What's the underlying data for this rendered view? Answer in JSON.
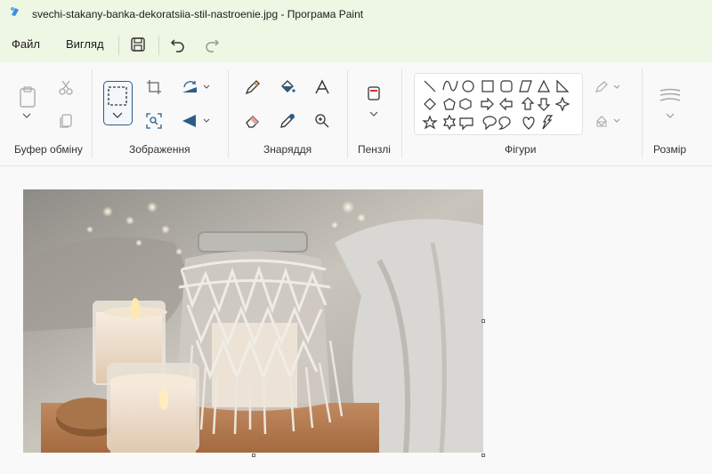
{
  "window": {
    "title": "svechi-stakany-banka-dekoratsiia-stil-nastroenie.jpg - Програма Paint",
    "app_icon": "paint-palette-icon"
  },
  "menubar": {
    "items": [
      "Файл",
      "Вигляд"
    ],
    "icons": [
      "save-icon",
      "undo-icon",
      "redo-icon"
    ]
  },
  "ribbon": {
    "groups": [
      {
        "label": "Буфер обміну",
        "tools": [
          "paste-icon",
          "cut-icon",
          "copy-icon"
        ]
      },
      {
        "label": "Зображення",
        "tools": [
          "select-icon",
          "crop-icon",
          "rotate-icon",
          "image-search-icon",
          "flip-icon"
        ]
      },
      {
        "label": "Знаряддя",
        "tools": [
          "pencil-icon",
          "fill-icon",
          "text-icon",
          "eraser-icon",
          "color-picker-icon",
          "magnifier-icon"
        ]
      },
      {
        "label": "Пензлі",
        "tools": [
          "brush-icon"
        ]
      },
      {
        "label": "Фігури",
        "tools": [
          "outline-icon",
          "fill-style-icon"
        ]
      },
      {
        "label": "Розмір",
        "tools": [
          "size-icon"
        ]
      }
    ],
    "shapes": [
      "line",
      "curve",
      "oval",
      "rectangle",
      "rounded-rectangle",
      "polygon",
      "triangle",
      "right-triangle",
      "diamond",
      "pentagon",
      "hexagon",
      "right-arrow",
      "left-arrow",
      "up-arrow",
      "down-arrow",
      "four-point-star",
      "five-point-star",
      "six-point-star",
      "rounded-callout",
      "oval-callout",
      "cloud-callout",
      "heart",
      "lightning"
    ]
  },
  "canvas": {
    "image_description_icon": "photo-candles-macrame-jar"
  },
  "colors": {
    "titlebar_bg": "#eef6e4",
    "accent": "#2c5d8a"
  }
}
